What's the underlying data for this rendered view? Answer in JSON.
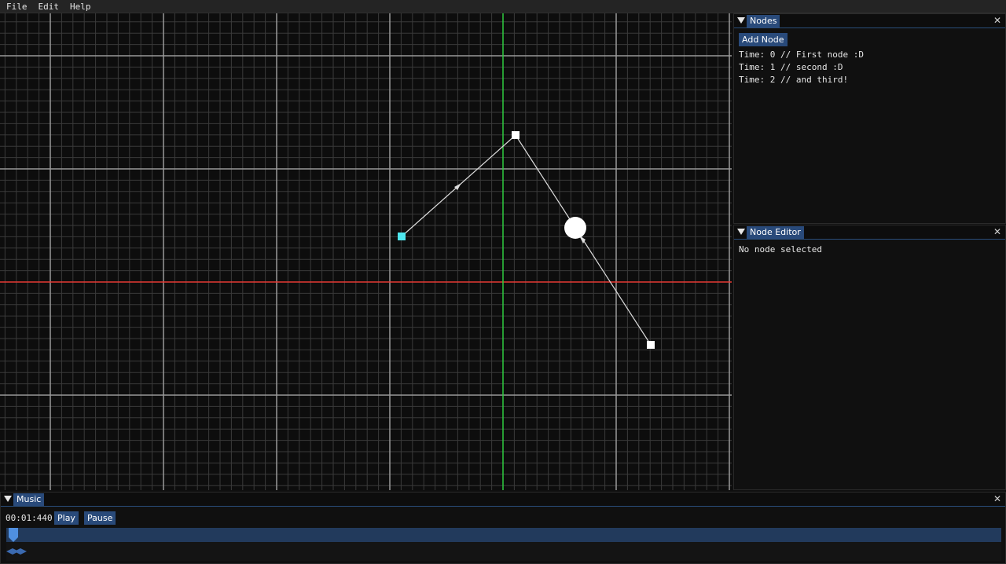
{
  "menu": {
    "items": [
      "File",
      "Edit",
      "Help"
    ]
  },
  "canvas": {
    "colors": {
      "background": "#0d0d0d",
      "grid_minor": "#3a3a3a",
      "grid_major": "#9a9a9a",
      "axis_x": "#e53935",
      "axis_y": "#2ecc40",
      "path": "#dddddd",
      "node": "#ffffff",
      "selected_node": "#4ee6ee"
    }
  },
  "nodes_panel": {
    "title": "Nodes",
    "add_button": "Add Node",
    "lines": [
      "Time: 0 // First node :D",
      "Time: 1 // second :D",
      "Time: 2 // and third!"
    ]
  },
  "editor_panel": {
    "title": "Node Editor",
    "status": "No node selected"
  },
  "music_panel": {
    "title": "Music",
    "time": "00:01:440",
    "play": "Play",
    "pause": "Pause"
  },
  "icons": {
    "collapse": "triangle-down-icon",
    "close": "close-icon"
  },
  "colors": {
    "accent": "#294a7a",
    "timeline": "#223a5c",
    "playhead": "#4f8fe0"
  }
}
